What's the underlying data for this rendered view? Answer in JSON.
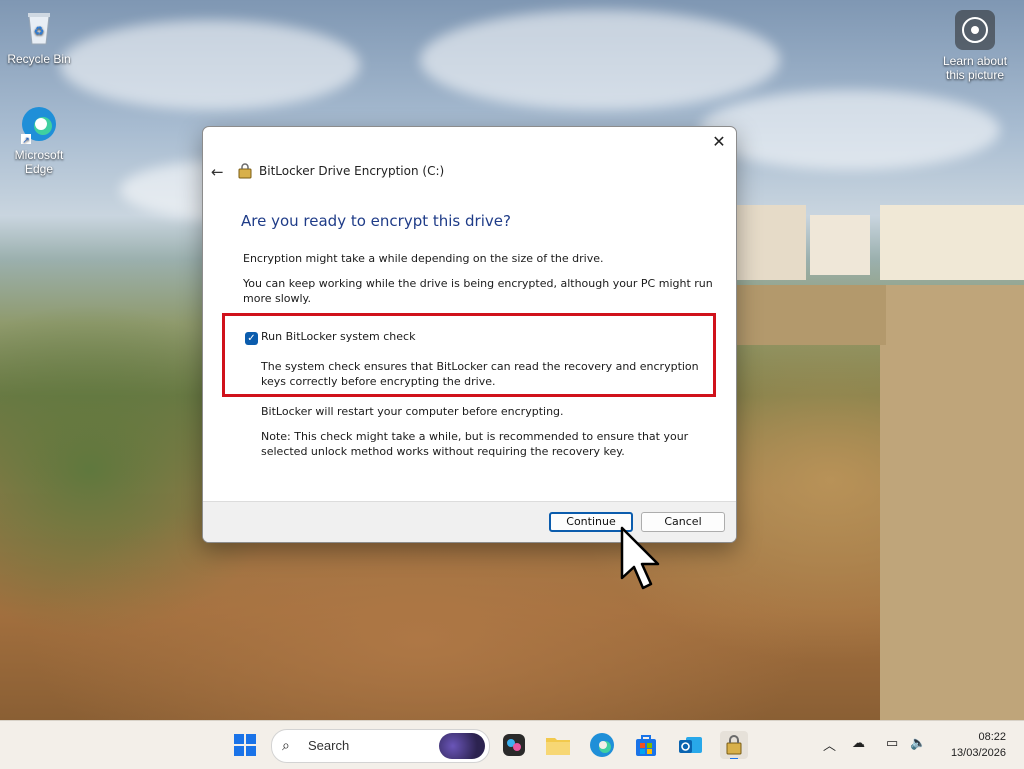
{
  "desktop": {
    "icons": [
      {
        "label": "Recycle Bin"
      },
      {
        "label": "Microsoft Edge"
      },
      {
        "label": "Learn about this picture"
      }
    ]
  },
  "dialog": {
    "title": "BitLocker Drive Encryption (C:)",
    "heading": "Are you ready to encrypt this drive?",
    "para1": "Encryption might take a while depending on the size of the drive.",
    "para2": "You can keep working while the drive is being encrypted, although your PC might run more slowly.",
    "checkbox_label": "Run BitLocker system check",
    "checkbox_checked": true,
    "check_description": "The system check ensures that BitLocker can read the recovery and encryption keys correctly before encrypting the drive.",
    "restart_note": "BitLocker will restart your computer before encrypting.",
    "note": "Note: This check might take a while, but is recommended to ensure that your selected unlock method works without requiring the recovery key.",
    "buttons": {
      "continue": "Continue",
      "cancel": "Cancel"
    },
    "highlight_color": "#d0111b"
  },
  "taskbar": {
    "search_placeholder": "Search",
    "pinned": [
      "start-icon",
      "copilot-icon",
      "file-explorer-icon",
      "edge-icon",
      "store-icon",
      "outlook-icon",
      "bitlocker-icon"
    ],
    "clock": {
      "time": "08:22",
      "date": "13/03/2026"
    }
  }
}
